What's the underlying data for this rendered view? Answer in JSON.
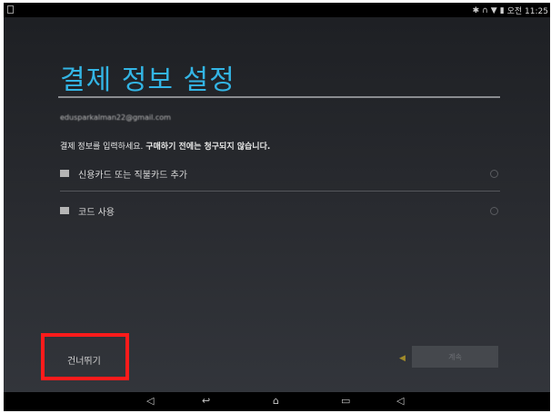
{
  "status_bar": {
    "time": "오전 11:25",
    "icons": [
      "bluetooth-icon",
      "headset-icon",
      "wifi-icon",
      "battery-icon"
    ]
  },
  "screen": {
    "title": "결제 정보 설정",
    "email": "edusparkalman22@gmail.com",
    "info_prefix": "결제 정보를 입력하세요. ",
    "info_bold": "구매하기 전에는 청구되지 않습니다."
  },
  "options": [
    {
      "label": "신용카드 또는 직불카드 추가",
      "icon": "credit-card-icon"
    },
    {
      "label": "코드 사용",
      "icon": "gift-icon"
    }
  ],
  "footer": {
    "skip_label": "건너뛰기",
    "next_label": "계속"
  },
  "nav": {
    "icons": [
      "volume-down-icon",
      "back-icon",
      "home-icon",
      "recents-icon",
      "volume-up-icon"
    ]
  },
  "colors": {
    "accent": "#33b5e5",
    "highlight": "#ff1b1b"
  }
}
